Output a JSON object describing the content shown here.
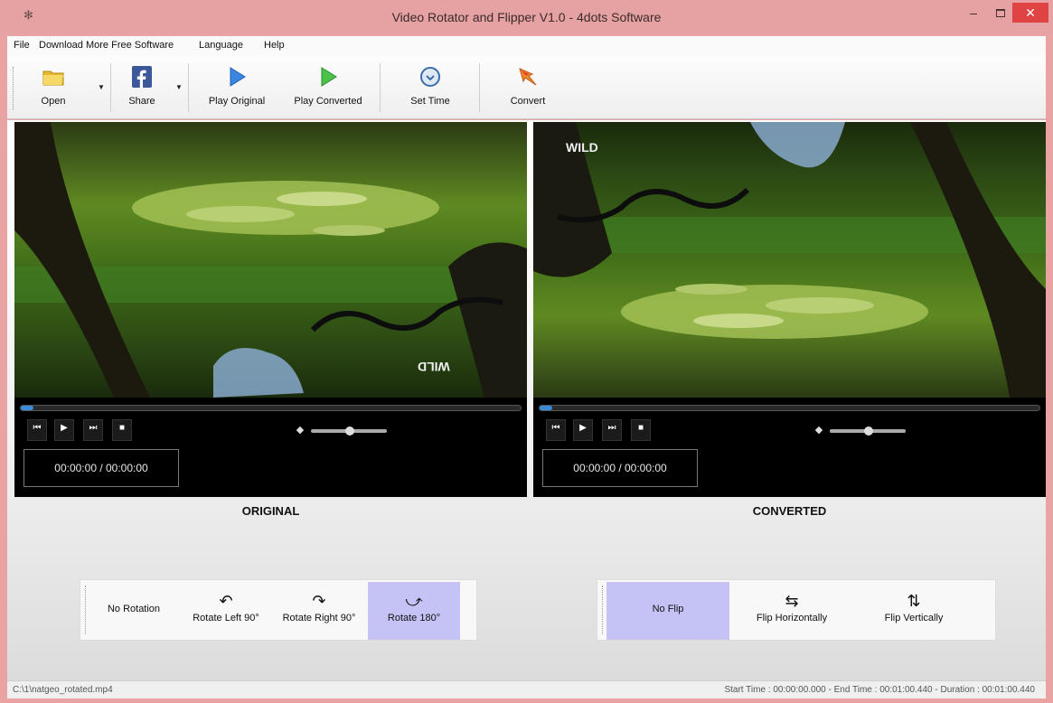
{
  "window": {
    "title": "Video Rotator and Flipper V1.0 - 4dots Software",
    "minimize": "–",
    "close": "✕"
  },
  "menu": [
    "File",
    "Download More Free Software",
    "Language",
    "Help"
  ],
  "toolbar": {
    "open": "Open",
    "share": "Share",
    "play_original": "Play Original",
    "play_converted": "Play Converted",
    "set_time": "Set Time",
    "convert": "Convert"
  },
  "players": {
    "original": {
      "caption": "ORIGINAL",
      "time": "00:00:00 / 00:00:00",
      "progress": 0.02,
      "volume": 0.6
    },
    "converted": {
      "caption": "CONVERTED",
      "time": "00:00:00 / 00:00:00",
      "progress": 0.02,
      "volume": 0.6
    },
    "watermark": "WILD"
  },
  "controls": {
    "prev": "⏮",
    "play": "▶",
    "next": "⏭",
    "stop": "■",
    "volume": "◆"
  },
  "rotation": {
    "options": [
      "No Rotation",
      "Rotate Left 90°",
      "Rotate Right 90°",
      "Rotate 180°"
    ],
    "selected": "Rotate 180°"
  },
  "flip": {
    "options": [
      "No Flip",
      "Flip Horizontally",
      "Flip Vertically"
    ],
    "selected": "No Flip"
  },
  "status": {
    "file": "C:\\1\\natgeo_rotated.mp4",
    "times": "Start Time : 00:00:00.000 - End Time : 00:01:00.440 - Duration : 00:01:00.440"
  },
  "icons": {
    "app": "app-icon",
    "open": "folder-icon",
    "share": "facebook-icon",
    "play": "play-icon",
    "set_time": "clock-icon",
    "convert": "convert-icon"
  },
  "colors": {
    "titlebar": "#e6a2a2",
    "close": "#e04343",
    "selected": "#c5c2f5",
    "seek": "#3d8ad9"
  }
}
